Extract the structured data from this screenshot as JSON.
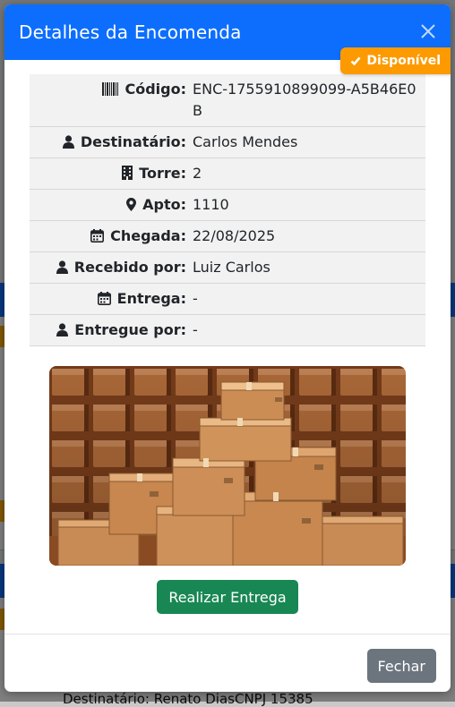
{
  "modal": {
    "title": "Detalhes da Encomenda",
    "status_badge": "Disponível",
    "fields": [
      {
        "label": "Código:",
        "value": "ENC-1755910899099-A5B46E0B",
        "icon": "barcode-icon"
      },
      {
        "label": "Destinatário:",
        "value": "Carlos Mendes",
        "icon": "user-icon"
      },
      {
        "label": "Torre:",
        "value": "2",
        "icon": "building-icon"
      },
      {
        "label": "Apto:",
        "value": "1110",
        "icon": "map-pin-icon"
      },
      {
        "label": "Chegada:",
        "value": "22/08/2025",
        "icon": "calendar-icon"
      },
      {
        "label": "Recebido por:",
        "value": "Luiz Carlos",
        "icon": "user-icon"
      },
      {
        "label": "Entrega:",
        "value": "-",
        "icon": "calendar-icon"
      },
      {
        "label": "Entregue por:",
        "value": "-",
        "icon": "user-icon"
      }
    ],
    "deliver_button": "Realizar Entrega",
    "footer_close_button": "Fechar"
  },
  "background": {
    "partial_text": "Destinatário: Renato DiasCNPJ 15385"
  },
  "colors": {
    "header": "#0d6efd",
    "badge": "#fd9a00",
    "deliver": "#198754",
    "close": "#6c757d"
  }
}
